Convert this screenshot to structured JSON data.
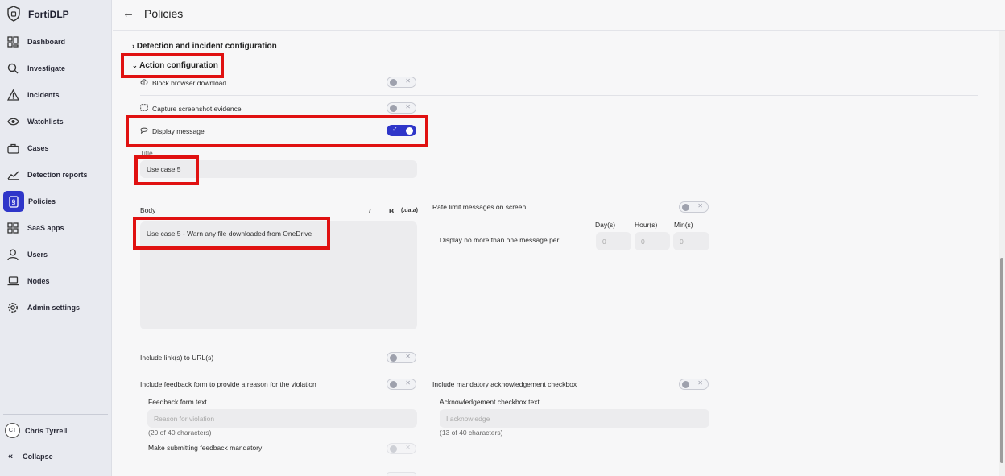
{
  "app": {
    "name": "FortiDLP"
  },
  "sidebar": {
    "items": [
      {
        "label": "Dashboard",
        "icon": "dashboard-icon"
      },
      {
        "label": "Investigate",
        "icon": "search-icon"
      },
      {
        "label": "Incidents",
        "icon": "warning-icon"
      },
      {
        "label": "Watchlists",
        "icon": "eye-icon"
      },
      {
        "label": "Cases",
        "icon": "briefcase-icon"
      },
      {
        "label": "Detection reports",
        "icon": "trend-icon"
      },
      {
        "label": "Policies",
        "icon": "policy-icon",
        "active": true
      },
      {
        "label": "SaaS apps",
        "icon": "apps-icon"
      },
      {
        "label": "Users",
        "icon": "user-icon"
      },
      {
        "label": "Nodes",
        "icon": "laptop-icon"
      },
      {
        "label": "Admin settings",
        "icon": "gear-icon"
      }
    ],
    "user": {
      "initials": "CT",
      "name": "Chris Tyrrell"
    },
    "collapse_label": "Collapse"
  },
  "header": {
    "title": "Policies"
  },
  "sections": {
    "detection": "Detection and incident configuration",
    "action": "Action configuration"
  },
  "actions": {
    "block_browser": {
      "label": "Block browser download",
      "enabled": false
    },
    "capture_screenshot": {
      "label": "Capture screenshot evidence",
      "enabled": false
    },
    "display_message": {
      "label": "Display message",
      "enabled": true
    }
  },
  "message": {
    "title_label": "Title",
    "title_value": "Use case 5",
    "body_label": "Body",
    "body_value": "Use case 5  - Warn any file downloaded from OneDrive",
    "format_italic": "I",
    "format_bold": "B",
    "format_data": "(.data)"
  },
  "rate_limit": {
    "label": "Rate limit messages on screen",
    "enabled": false,
    "display_text": "Display no more than one message per",
    "days_label": "Day(s)",
    "hours_label": "Hour(s)",
    "mins_label": "Min(s)",
    "days_value": "0",
    "hours_value": "0",
    "mins_value": "0"
  },
  "include_links": {
    "label": "Include link(s) to URL(s)",
    "enabled": false
  },
  "feedback": {
    "label": "Include feedback form to provide a reason for the violation",
    "enabled": false,
    "text_label": "Feedback form text",
    "placeholder": "Reason for violation",
    "count": "(20 of 40 characters)",
    "mandatory_label": "Make submitting feedback mandatory"
  },
  "acknowledgement": {
    "label": "Include mandatory acknowledgement checkbox",
    "enabled": false,
    "text_label": "Acknowledgement checkbox text",
    "placeholder": "I acknowledge",
    "count": "(13 of 40 characters)"
  },
  "colors": {
    "accent": "#2f36c9",
    "highlight": "#e01111"
  }
}
